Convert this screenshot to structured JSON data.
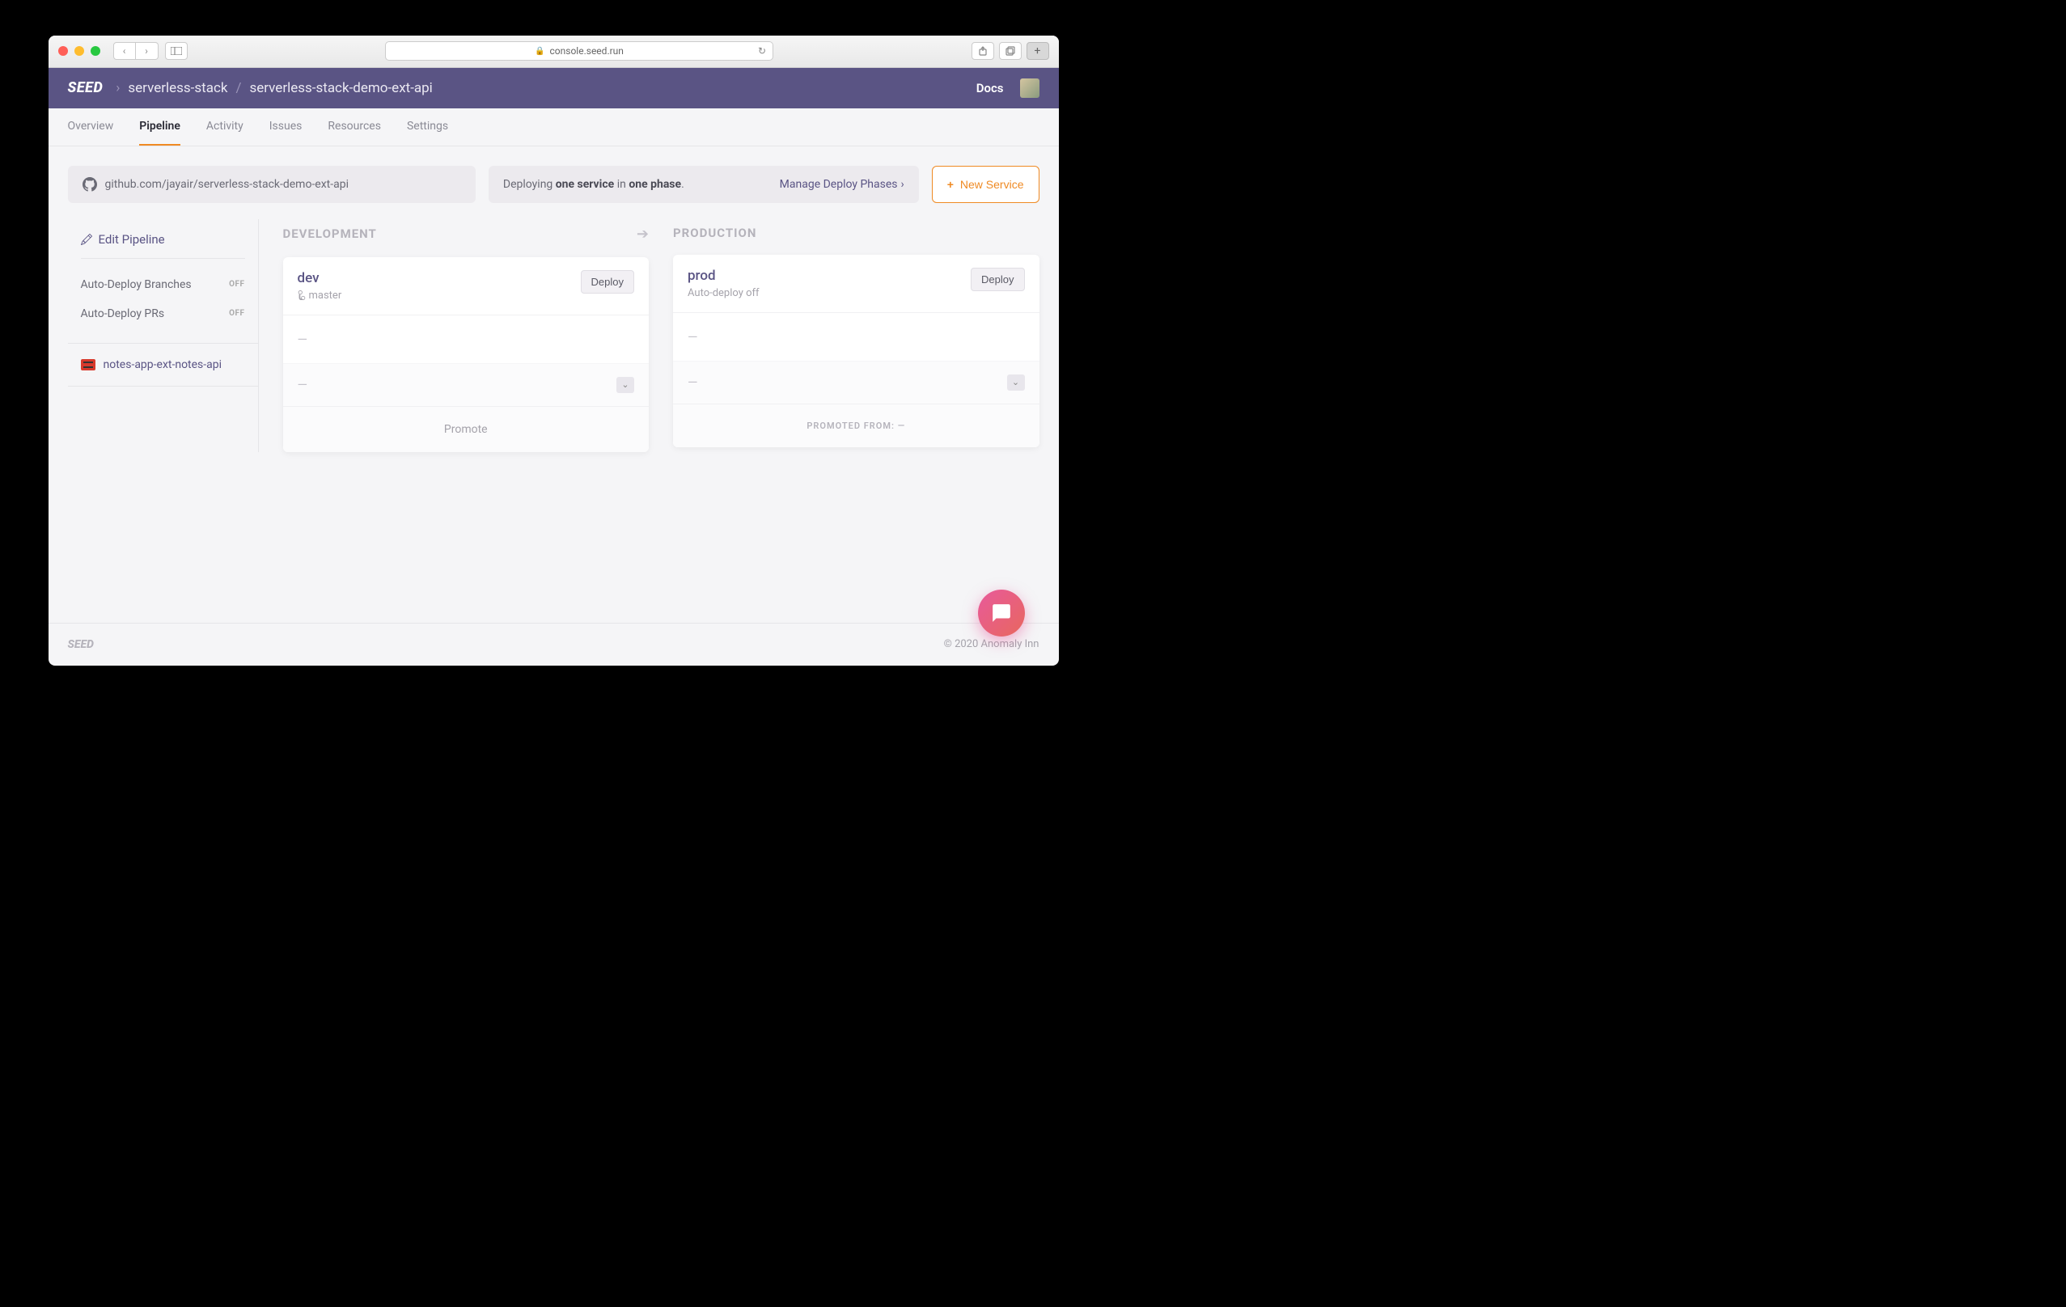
{
  "browser": {
    "url": "console.seed.run"
  },
  "header": {
    "logo": "SEED",
    "breadcrumb": {
      "org": "serverless-stack",
      "project": "serverless-stack-demo-ext-api"
    },
    "docs": "Docs"
  },
  "tabs": [
    {
      "label": "Overview",
      "active": false
    },
    {
      "label": "Pipeline",
      "active": true
    },
    {
      "label": "Activity",
      "active": false
    },
    {
      "label": "Issues",
      "active": false
    },
    {
      "label": "Resources",
      "active": false
    },
    {
      "label": "Settings",
      "active": false
    }
  ],
  "info": {
    "repo": "github.com/jayair/serverless-stack-demo-ext-api",
    "deploy_prefix": "Deploying ",
    "deploy_service": "one service",
    "deploy_middle": " in ",
    "deploy_phase": "one phase",
    "deploy_suffix": ".",
    "manage": "Manage Deploy Phases",
    "new_service": "New Service"
  },
  "sidebar": {
    "edit": "Edit Pipeline",
    "branches": "Auto-Deploy Branches",
    "branches_state": "OFF",
    "prs": "Auto-Deploy PRs",
    "prs_state": "OFF",
    "service": "notes-app-ext-notes-api"
  },
  "stages": {
    "development": {
      "label": "DEVELOPMENT",
      "env_name": "dev",
      "branch": "master",
      "deploy_btn": "Deploy",
      "dash1": "—",
      "dash2": "—",
      "footer": "Promote"
    },
    "production": {
      "label": "PRODUCTION",
      "env_name": "prod",
      "subtitle": "Auto-deploy off",
      "deploy_btn": "Deploy",
      "dash1": "—",
      "dash2": "—",
      "footer": "PROMOTED FROM: —"
    }
  },
  "footer": {
    "logo": "SEED",
    "copyright": "© 2020 Anomaly Inn"
  }
}
